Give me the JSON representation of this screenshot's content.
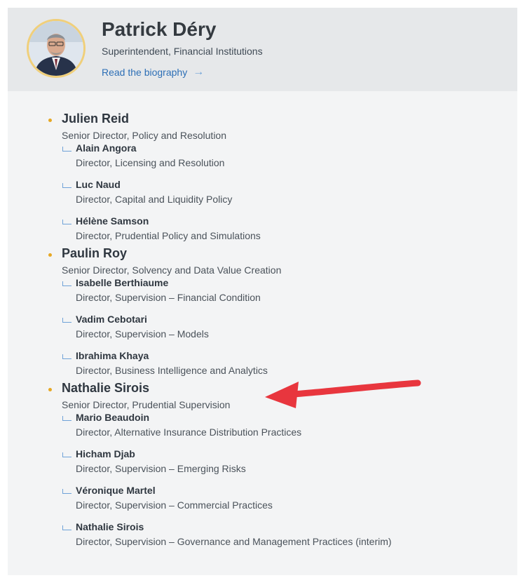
{
  "header": {
    "name": "Patrick Déry",
    "title": "Superintendent, Financial Institutions",
    "bio_link": "Read the biography",
    "bio_icon": "arrow-right-icon"
  },
  "groups": [
    {
      "name": "Julien Reid",
      "title": "Senior Director, Policy and Resolution",
      "members": [
        {
          "name": "Alain Angora",
          "title": "Director, Licensing and Resolution"
        },
        {
          "name": "Luc Naud",
          "title": "Director, Capital and Liquidity Policy"
        },
        {
          "name": "Hélène Samson",
          "title": "Director, Prudential Policy and Simulations"
        }
      ]
    },
    {
      "name": "Paulin Roy",
      "title": "Senior Director, Solvency and Data Value Creation",
      "members": [
        {
          "name": "Isabelle Berthiaume",
          "title": "Director, Supervision – Financial Condition"
        },
        {
          "name": "Vadim Cebotari",
          "title": "Director, Supervision – Models"
        },
        {
          "name": "Ibrahima Khaya",
          "title": "Director, Business Intelligence and Analytics"
        }
      ]
    },
    {
      "name": "Nathalie Sirois",
      "title": "Senior Director, Prudential Supervision",
      "members": [
        {
          "name": "Mario Beaudoin",
          "title": "Director, Alternative Insurance Distribution Practices"
        },
        {
          "name": "Hicham Djab",
          "title": "Director, Supervision – Emerging Risks"
        },
        {
          "name": "Véronique Martel",
          "title": "Director, Supervision – Commercial Practices"
        },
        {
          "name": "Nathalie Sirois",
          "title": "Director, Supervision – Governance and Management Practices (interim)"
        }
      ]
    }
  ],
  "colors": {
    "bullet": "#e6a824",
    "link": "#2d6fb6",
    "annotation_arrow": "#e8363e"
  }
}
